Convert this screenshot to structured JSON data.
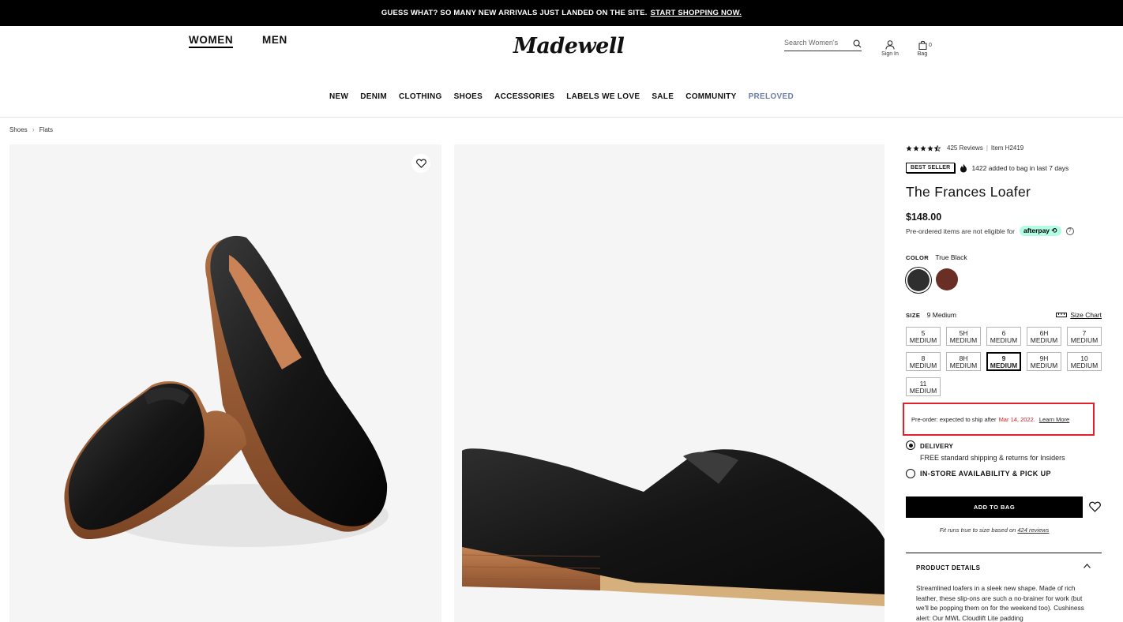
{
  "promo": {
    "text": "GUESS WHAT? SO MANY NEW ARRIVALS JUST LANDED ON THE SITE.",
    "link": "START SHOPPING NOW."
  },
  "header": {
    "women": "WOMEN",
    "men": "MEN",
    "logo": "Madewell",
    "search_placeholder": "Search Women's",
    "sign_in": "Sign In",
    "bag_label": "Bag",
    "bag_count": "0"
  },
  "nav": [
    "NEW",
    "DENIM",
    "CLOTHING",
    "SHOES",
    "ACCESSORIES",
    "LABELS WE LOVE",
    "SALE",
    "COMMUNITY",
    "PRELOVED"
  ],
  "breadcrumb": [
    "Shoes",
    "Flats"
  ],
  "product": {
    "rating": 4.5,
    "reviews": "425 Reviews",
    "item": "Item H2419",
    "badge": "BEST SELLER",
    "added": "1422 added to bag in last 7 days",
    "title": "The Frances Loafer",
    "price": "$148.00",
    "afterpay_note": "Pre-ordered items are not eligible for",
    "afterpay": "afterpay",
    "color_heading": "COLOR",
    "color_value": "True Black",
    "size_heading": "SIZE",
    "size_value": "9 Medium",
    "size_chart": "Size Chart",
    "sizes": [
      [
        "5",
        "MEDIUM"
      ],
      [
        "5H",
        "MEDIUM"
      ],
      [
        "6",
        "MEDIUM"
      ],
      [
        "6H",
        "MEDIUM"
      ],
      [
        "7",
        "MEDIUM"
      ],
      [
        "8",
        "MEDIUM"
      ],
      [
        "8H",
        "MEDIUM"
      ],
      [
        "9",
        "MEDIUM"
      ],
      [
        "9H",
        "MEDIUM"
      ],
      [
        "10",
        "MEDIUM"
      ],
      [
        "11",
        "MEDIUM"
      ]
    ],
    "selected_size_index": 7,
    "preorder_text": "Pre-order: expected to ship after",
    "preorder_date": "Mar 14, 2022.",
    "learn_more": "Learn More",
    "delivery": "DELIVERY",
    "delivery_free": "FREE standard shipping & returns",
    "delivery_for": "for Insiders",
    "pickup": "IN-STORE AVAILABILITY & PICK UP",
    "add_to_bag": "ADD TO BAG",
    "fit_note": "Fit runs true to size based on",
    "fit_link": "424 reviews",
    "details_heading": "PRODUCT DETAILS",
    "details_body": "Streamlined loafers in a sleek new shape. Made of rich leather, these slip-ons are such a no-brainer for work (but we'll be popping them on for the weekend too). Cushiness alert: Our MWL Cloudlift Lite padding"
  },
  "colors": {
    "accent_red": "#e0202b",
    "afterpay_mint": "#b2fce4",
    "preloved_blue": "#6d7ea6"
  }
}
